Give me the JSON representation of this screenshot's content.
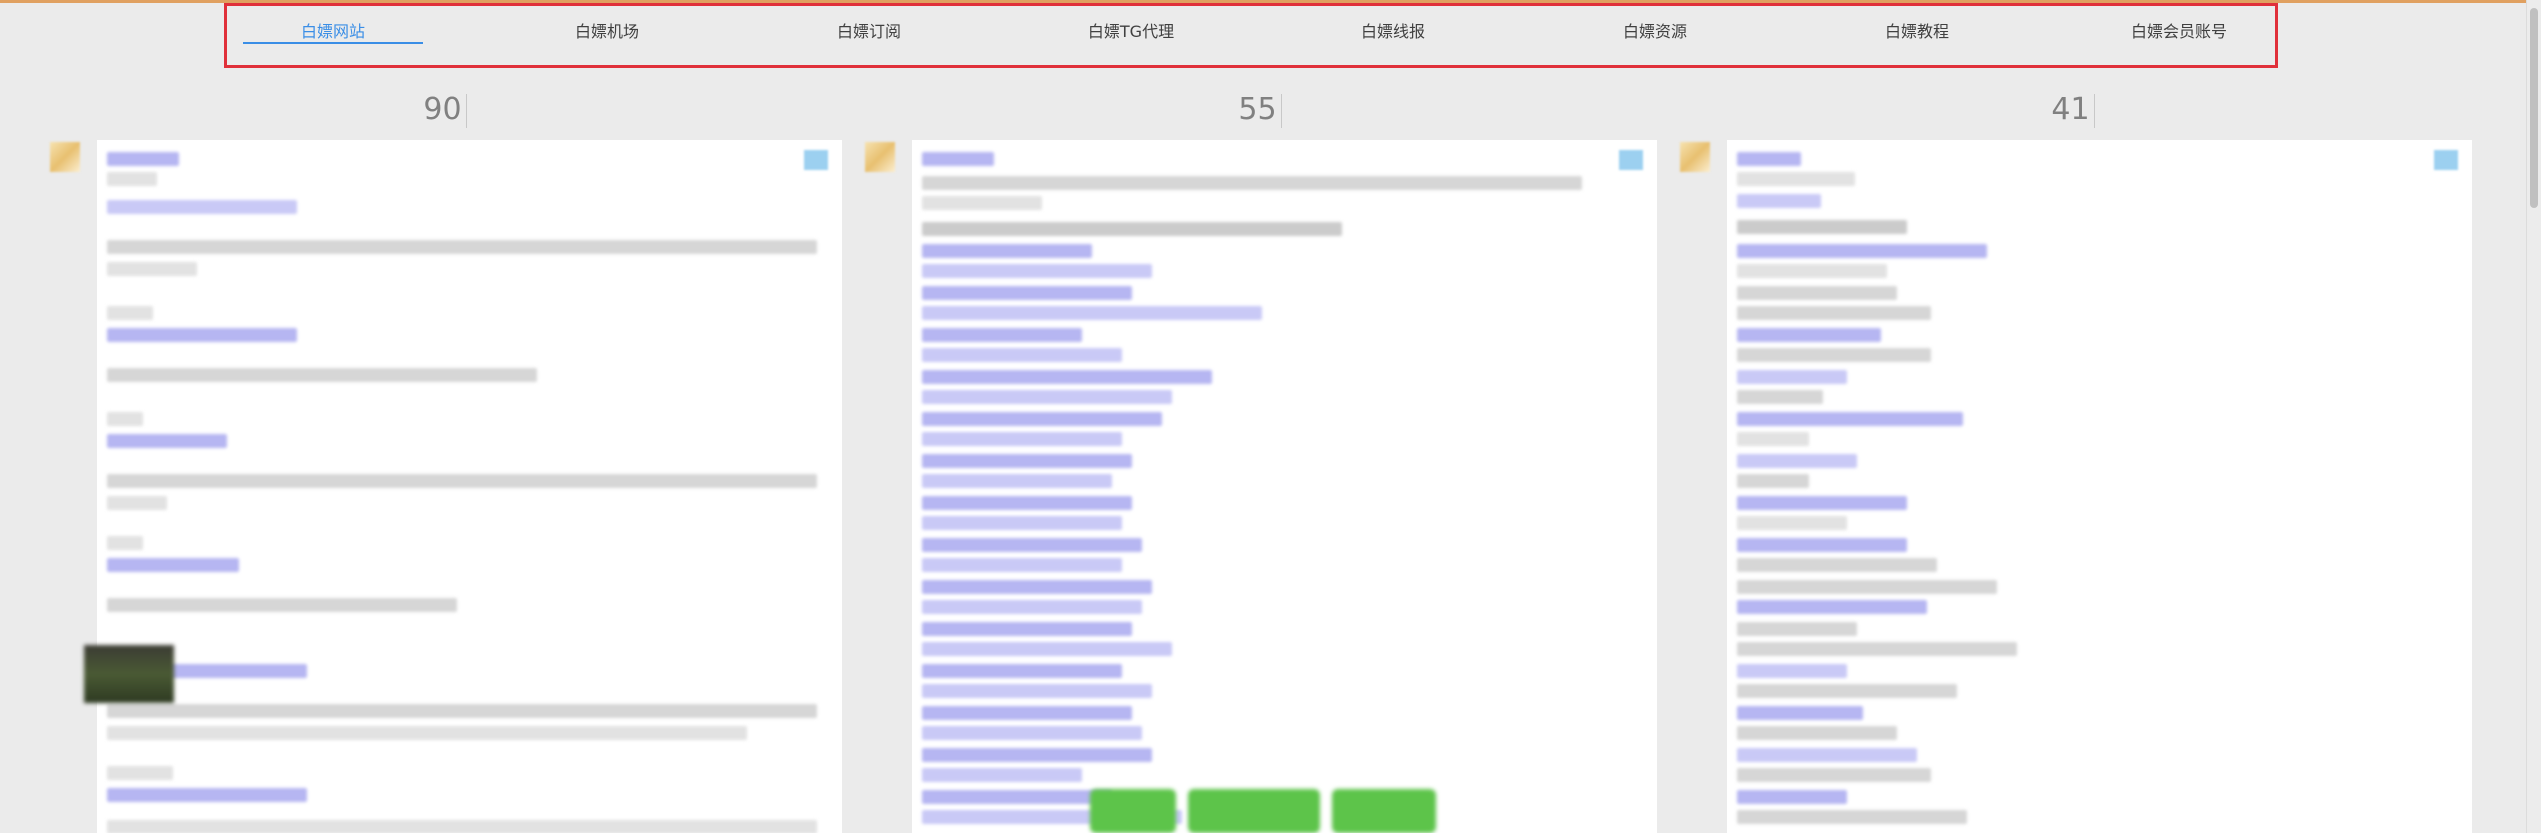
{
  "nav": {
    "tabs": [
      {
        "label": "白嫖网站",
        "active": true
      },
      {
        "label": "白嫖机场",
        "active": false
      },
      {
        "label": "白嫖订阅",
        "active": false
      },
      {
        "label": "白嫖TG代理",
        "active": false
      },
      {
        "label": "白嫖线报",
        "active": false
      },
      {
        "label": "白嫖资源",
        "active": false
      },
      {
        "label": "白嫖教程",
        "active": false
      },
      {
        "label": "白嫖会员账号",
        "active": false
      }
    ]
  },
  "columns": [
    {
      "count": "90"
    },
    {
      "count": "55"
    },
    {
      "count": "41"
    }
  ],
  "colors": {
    "accent": "#3a8ee6",
    "highlight_border": "#e0303a",
    "link_blur": "#b6b6f2",
    "button_green": "#5dc44a"
  },
  "icons": {
    "avatar": "avatar-icon",
    "corner": "image-icon"
  }
}
